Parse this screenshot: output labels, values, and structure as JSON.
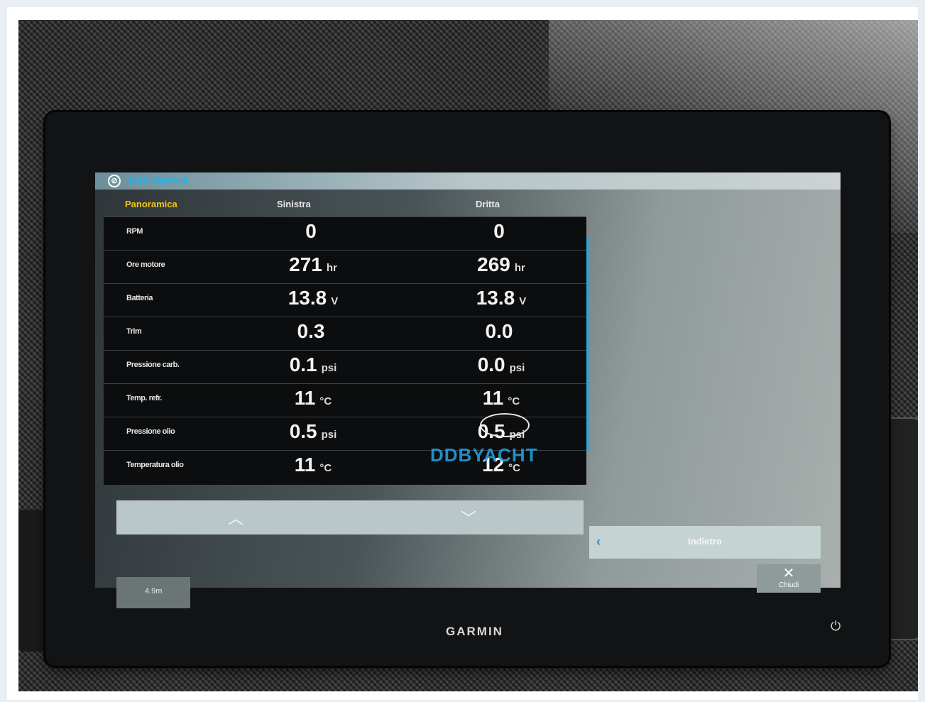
{
  "screen": {
    "title": "Dati motore",
    "tabs": {
      "overview": "Panoramica",
      "left": "Sinistra",
      "right": "Dritta"
    },
    "rows": [
      {
        "label": "RPM",
        "left": "0",
        "left_unit": "",
        "right": "0",
        "right_unit": ""
      },
      {
        "label": "Ore motore",
        "left": "271",
        "left_unit": "hr",
        "right": "269",
        "right_unit": "hr"
      },
      {
        "label": "Batteria",
        "left": "13.8",
        "left_unit": "V",
        "right": "13.8",
        "right_unit": "V"
      },
      {
        "label": "Trim",
        "left": "0.3",
        "left_unit": "",
        "right": "0.0",
        "right_unit": ""
      },
      {
        "label": "Pressione carb.",
        "left": "0.1",
        "left_unit": "psi",
        "right": "0.0",
        "right_unit": "psi"
      },
      {
        "label": "Temp. refr.",
        "left": "11",
        "left_unit": "°C",
        "right": "11",
        "right_unit": "°C"
      },
      {
        "label": "Pressione olio",
        "left": "0.5",
        "left_unit": "psi",
        "right": "0.5",
        "right_unit": "psi"
      },
      {
        "label": "Temperatura olio",
        "left": "11",
        "left_unit": "°C",
        "right": "12",
        "right_unit": "°C"
      }
    ],
    "nav": {
      "up_icon": "chevron-up-icon",
      "down_icon": "chevron-down-icon"
    },
    "back_label": "Indietro",
    "close_label": "Chiudi",
    "status_value": "4.9m"
  },
  "device": {
    "brand": "GARMIN"
  },
  "watermark": "DDBYACHT",
  "colors": {
    "accent": "#1ea6e6",
    "tab_active": "#f5c518"
  }
}
